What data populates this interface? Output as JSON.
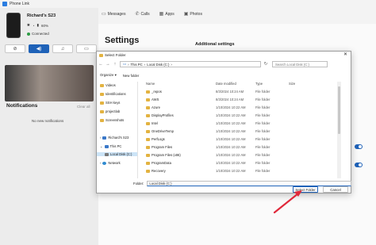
{
  "app": {
    "title": "Phone Link",
    "device_name": "Richard's S23",
    "battery": "60%",
    "connection": "Connected",
    "notifications_title": "Notifications",
    "clear_all": "Clear all",
    "no_notifications": "No new notifications",
    "nav": [
      {
        "label": "Messages",
        "icon": "messages-icon"
      },
      {
        "label": "Calls",
        "icon": "calls-icon"
      },
      {
        "label": "Apps",
        "icon": "apps-icon"
      },
      {
        "label": "Photos",
        "icon": "photos-icon"
      }
    ],
    "settings_title": "Settings",
    "additional_settings": "Additional settings"
  },
  "dialog": {
    "title": "Select Folder",
    "path": [
      "This PC",
      "Local Disk (C:)"
    ],
    "search_placeholder": "Search Local Disk (C:)",
    "organize": "Organize",
    "new_folder": "New folder",
    "tree": [
      {
        "label": "Videos",
        "icon": "folder-icon"
      },
      {
        "label": "Identifications",
        "icon": "folder-icon"
      },
      {
        "label": "SSH keys",
        "icon": "folder-icon"
      },
      {
        "label": "projectlab",
        "icon": "folder-icon"
      },
      {
        "label": "Screenshots",
        "icon": "folder-icon"
      },
      {
        "label": "Richard's S23",
        "icon": "phone-icon"
      },
      {
        "label": "This PC",
        "icon": "pc-icon"
      },
      {
        "label": "Local Disk (C:)",
        "icon": "disk-icon"
      },
      {
        "label": "Network",
        "icon": "network-icon"
      }
    ],
    "columns": [
      "Name",
      "Date modified",
      "Type",
      "Size"
    ],
    "files": [
      {
        "name": "_repos",
        "date": "8/3/2024 10:24 AM",
        "type": "File folder"
      },
      {
        "name": "AWS",
        "date": "8/3/2024 10:24 AM",
        "type": "File folder"
      },
      {
        "name": "Azure",
        "date": "1/10/2024 10:22 AM",
        "type": "File folder"
      },
      {
        "name": "DisplayProfiles",
        "date": "1/10/2024 10:22 AM",
        "type": "File folder"
      },
      {
        "name": "Intel",
        "date": "1/10/2024 10:22 AM",
        "type": "File folder"
      },
      {
        "name": "OneDriveTemp",
        "date": "1/10/2024 10:22 AM",
        "type": "File folder"
      },
      {
        "name": "PerfLogs",
        "date": "1/10/2024 10:22 AM",
        "type": "File folder"
      },
      {
        "name": "Program Files",
        "date": "1/10/2024 10:22 AM",
        "type": "File folder"
      },
      {
        "name": "Program Files (x86)",
        "date": "1/10/2024 10:22 AM",
        "type": "File folder"
      },
      {
        "name": "ProgramData",
        "date": "1/10/2024 10:22 AM",
        "type": "File folder"
      },
      {
        "name": "Recovery",
        "date": "1/10/2024 10:22 AM",
        "type": "File folder"
      }
    ],
    "folder_label": "Folder:",
    "folder_value": "Local Disk (C:)",
    "select_button": "Select Folder",
    "cancel_button": "Cancel"
  },
  "colors": {
    "accent": "#1f62b8",
    "annotation_arrow": "#e0283a"
  }
}
